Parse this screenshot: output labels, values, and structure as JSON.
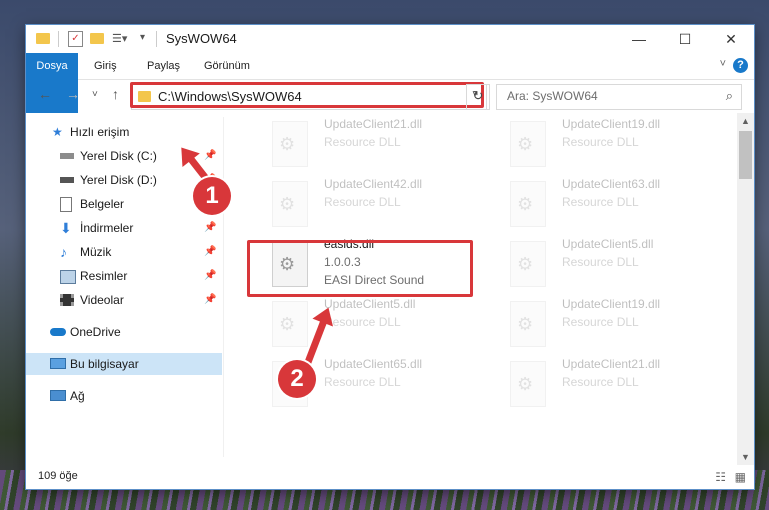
{
  "window": {
    "title": "SysWOW64",
    "controls": {
      "minimize": "—",
      "maximize": "☐",
      "close": "✕"
    }
  },
  "ribbon": {
    "tabs": [
      "Dosya",
      "Giriş",
      "Paylaş",
      "Görünüm"
    ],
    "help": "?"
  },
  "navigation": {
    "address": "C:\\Windows\\SysWOW64",
    "search_placeholder": "Ara: SysWOW64"
  },
  "sidebar": {
    "items": [
      {
        "label": "Hızlı erişim",
        "icon": "star-icon",
        "pinned": false
      },
      {
        "label": "Yerel Disk (C:)",
        "icon": "drive-icon",
        "pinned": true
      },
      {
        "label": "Yerel Disk (D:)",
        "icon": "drive-icon",
        "pinned": true
      },
      {
        "label": "Belgeler",
        "icon": "document-icon",
        "pinned": true
      },
      {
        "label": "İndirmeler",
        "icon": "download-icon",
        "pinned": true
      },
      {
        "label": "Müzik",
        "icon": "music-icon",
        "pinned": true
      },
      {
        "label": "Resimler",
        "icon": "pictures-icon",
        "pinned": true
      },
      {
        "label": "Videolar",
        "icon": "video-icon",
        "pinned": true
      },
      {
        "label": "OneDrive",
        "icon": "cloud-icon",
        "pinned": false
      },
      {
        "label": "Bu bilgisayar",
        "icon": "computer-icon",
        "pinned": false,
        "selected": true
      },
      {
        "label": "Ağ",
        "icon": "network-icon",
        "pinned": false
      }
    ]
  },
  "files": [
    {
      "name": "UpdateClient21.dll",
      "desc": "Resource DLL"
    },
    {
      "name": "UpdateClient19.dll",
      "desc": "Resource DLL"
    },
    {
      "name": "UpdateClient42.dll",
      "desc": "Resource DLL"
    },
    {
      "name": "UpdateClient63.dll",
      "desc": "Resource DLL"
    },
    {
      "name": "easids.dll",
      "version": "1.0.0.3",
      "desc": "EASI Direct Sound"
    },
    {
      "name": "UpdateClient5.dll",
      "desc": "Resource DLL"
    },
    {
      "name": "UpdateClient5.dll",
      "desc": "Resource DLL"
    },
    {
      "name": "UpdateClient19.dll",
      "desc": "Resource DLL"
    },
    {
      "name": "UpdateClient65.dll",
      "desc": "Resource DLL"
    },
    {
      "name": "UpdateClient21.dll",
      "desc": "Resource DLL"
    }
  ],
  "status": {
    "count": "109 öğe"
  },
  "callouts": [
    "1",
    "2"
  ],
  "colors": {
    "accent": "#1979ca",
    "highlight": "#d8373a"
  }
}
